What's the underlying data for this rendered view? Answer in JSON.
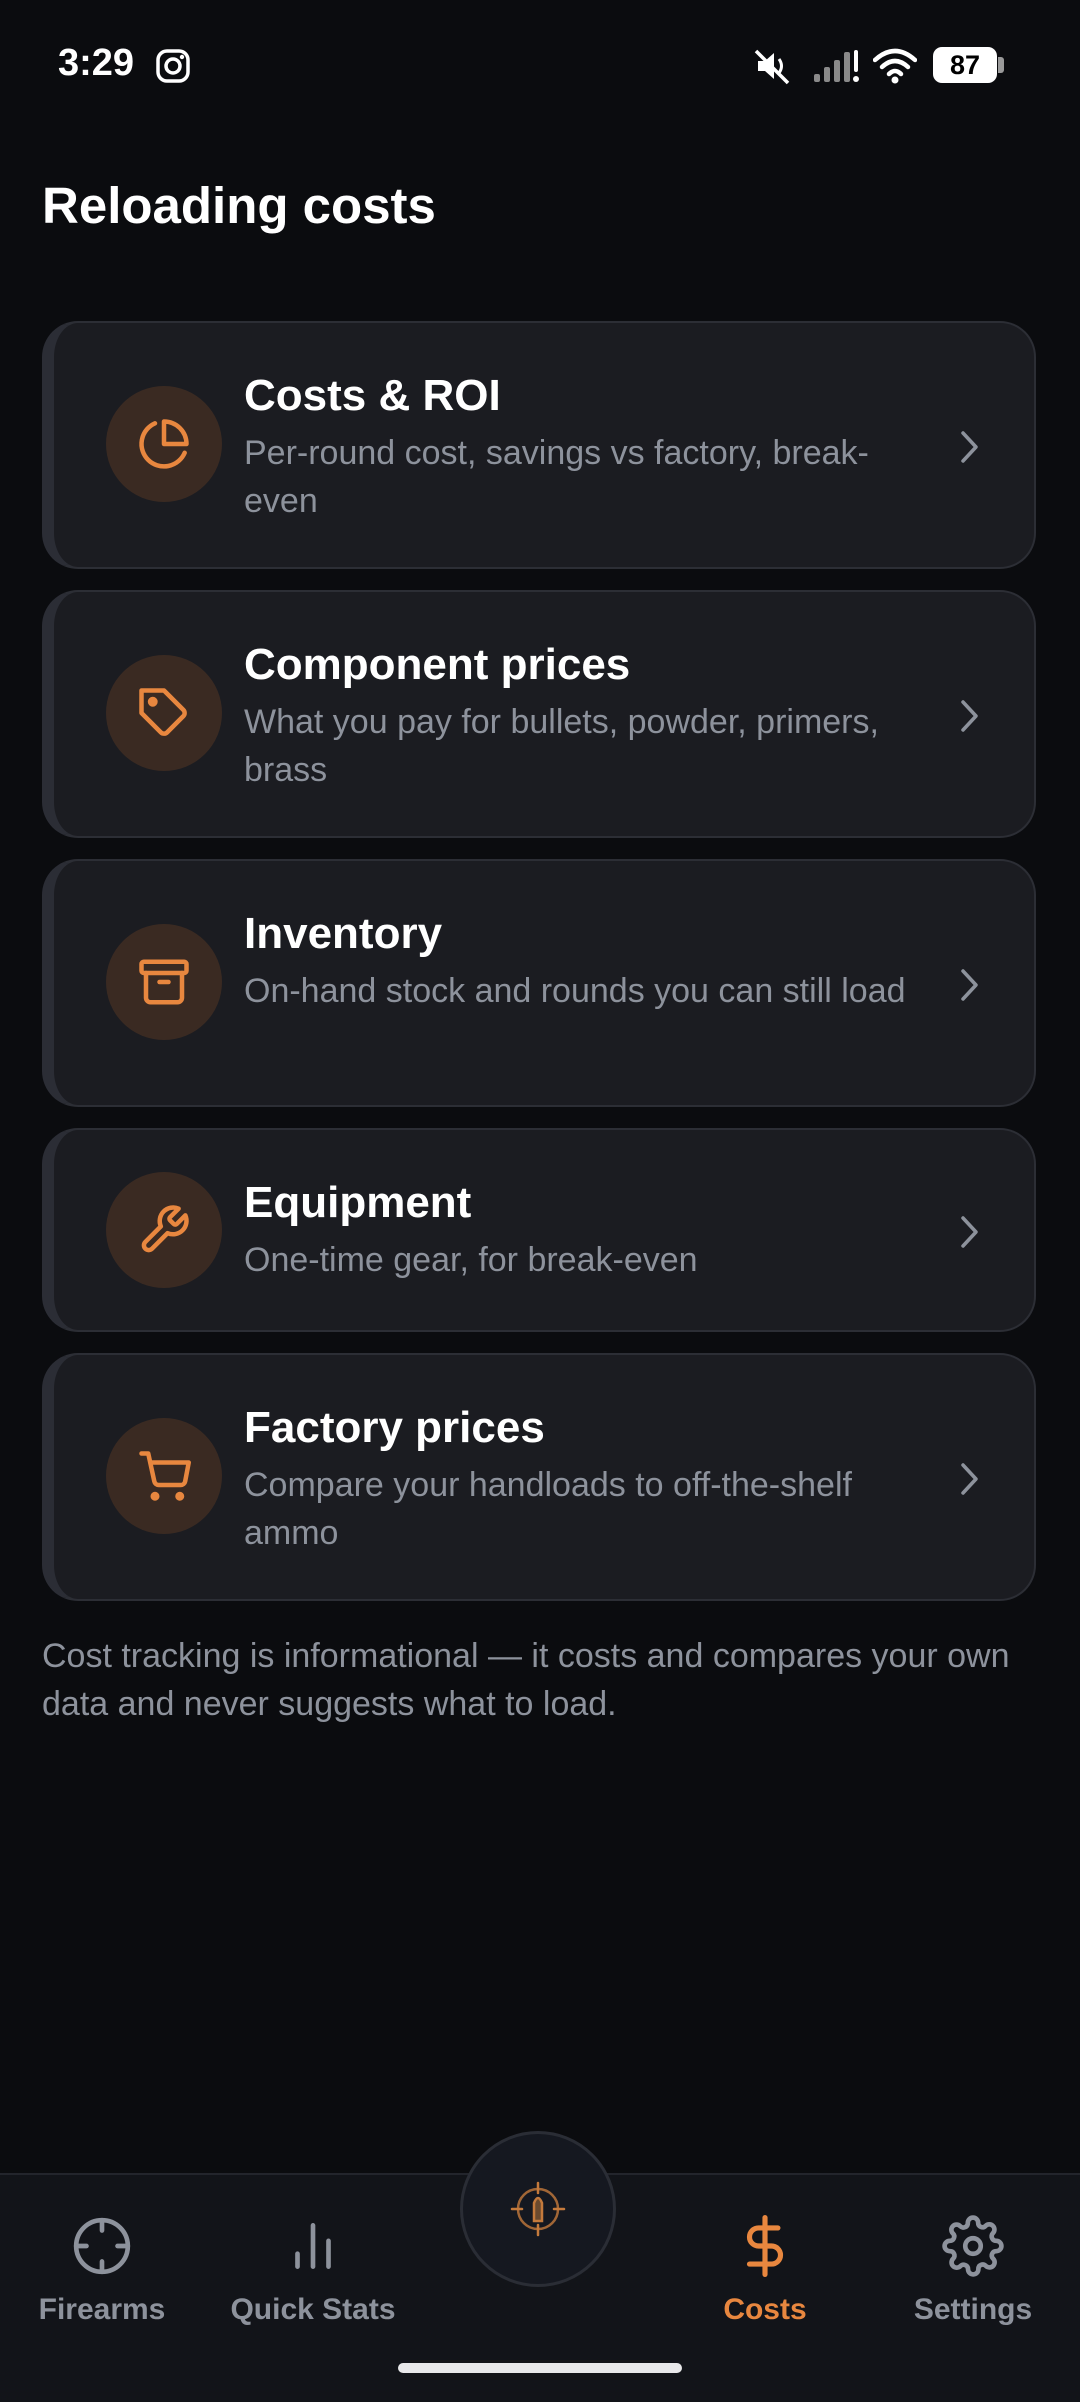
{
  "status_bar": {
    "time": "3:29",
    "battery": "87"
  },
  "page": {
    "title": "Reloading costs"
  },
  "cards": [
    {
      "title": "Costs & ROI",
      "subtitle": "Per-round cost, savings vs factory, break-even",
      "icon": "pie-chart-icon"
    },
    {
      "title": "Component prices",
      "subtitle": "What you pay for bullets, powder, primers, brass",
      "icon": "tag-icon"
    },
    {
      "title": "Inventory",
      "subtitle": "On-hand stock and rounds you can still load",
      "icon": "archive-box-icon"
    },
    {
      "title": "Equipment",
      "subtitle": "One-time gear, for break-even",
      "icon": "wrench-icon"
    },
    {
      "title": "Factory prices",
      "subtitle": "Compare your handloads to off-the-shelf ammo",
      "icon": "shopping-cart-icon"
    }
  ],
  "footnote": "Cost tracking is informational — it costs and compares your own data and never suggests what to load.",
  "nav": {
    "items": [
      {
        "label": "Firearms",
        "icon": "crosshair-icon"
      },
      {
        "label": "Quick Stats",
        "icon": "bar-chart-icon"
      },
      {
        "label": "Costs",
        "icon": "dollar-icon",
        "active": true
      },
      {
        "label": "Settings",
        "icon": "gear-icon"
      }
    ]
  },
  "colors": {
    "accent": "#e8873f",
    "background": "#0b0c0f",
    "card": "#1b1c21",
    "muted_text": "#8d929c"
  }
}
